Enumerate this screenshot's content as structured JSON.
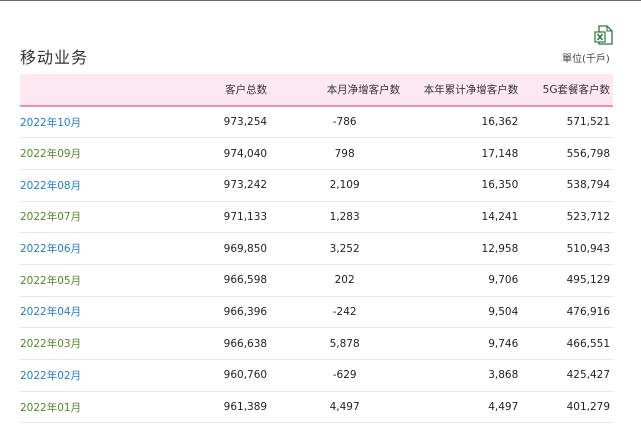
{
  "header": {
    "title": "移动业务",
    "unit": "單位(千戶)",
    "export_icon": "excel-export-icon"
  },
  "colors": {
    "header_bg": "#fde7f1",
    "header_border": "#ea8fbc",
    "month_blue": "#1f7fc4",
    "month_green": "#4f8a25"
  },
  "table": {
    "columns": [
      "",
      "客户总数",
      "本月净增客户数",
      "本年累计净增客户数",
      "5G套餐客户数"
    ],
    "rows": [
      {
        "month": "2022年10月",
        "total": "973,254",
        "monthly_net": "-786",
        "ytd_net": "16,362",
        "fiveg": "571,521"
      },
      {
        "month": "2022年09月",
        "total": "974,040",
        "monthly_net": "798",
        "ytd_net": "17,148",
        "fiveg": "556,798"
      },
      {
        "month": "2022年08月",
        "total": "973,242",
        "monthly_net": "2,109",
        "ytd_net": "16,350",
        "fiveg": "538,794"
      },
      {
        "month": "2022年07月",
        "total": "971,133",
        "monthly_net": "1,283",
        "ytd_net": "14,241",
        "fiveg": "523,712"
      },
      {
        "month": "2022年06月",
        "total": "969,850",
        "monthly_net": "3,252",
        "ytd_net": "12,958",
        "fiveg": "510,943"
      },
      {
        "month": "2022年05月",
        "total": "966,598",
        "monthly_net": "202",
        "ytd_net": "9,706",
        "fiveg": "495,129"
      },
      {
        "month": "2022年04月",
        "total": "966,396",
        "monthly_net": "-242",
        "ytd_net": "9,504",
        "fiveg": "476,916"
      },
      {
        "month": "2022年03月",
        "total": "966,638",
        "monthly_net": "5,878",
        "ytd_net": "9,746",
        "fiveg": "466,551"
      },
      {
        "month": "2022年02月",
        "total": "960,760",
        "monthly_net": "-629",
        "ytd_net": "3,868",
        "fiveg": "425,427"
      },
      {
        "month": "2022年01月",
        "total": "961,389",
        "monthly_net": "4,497",
        "ytd_net": "4,497",
        "fiveg": "401,279"
      }
    ]
  }
}
